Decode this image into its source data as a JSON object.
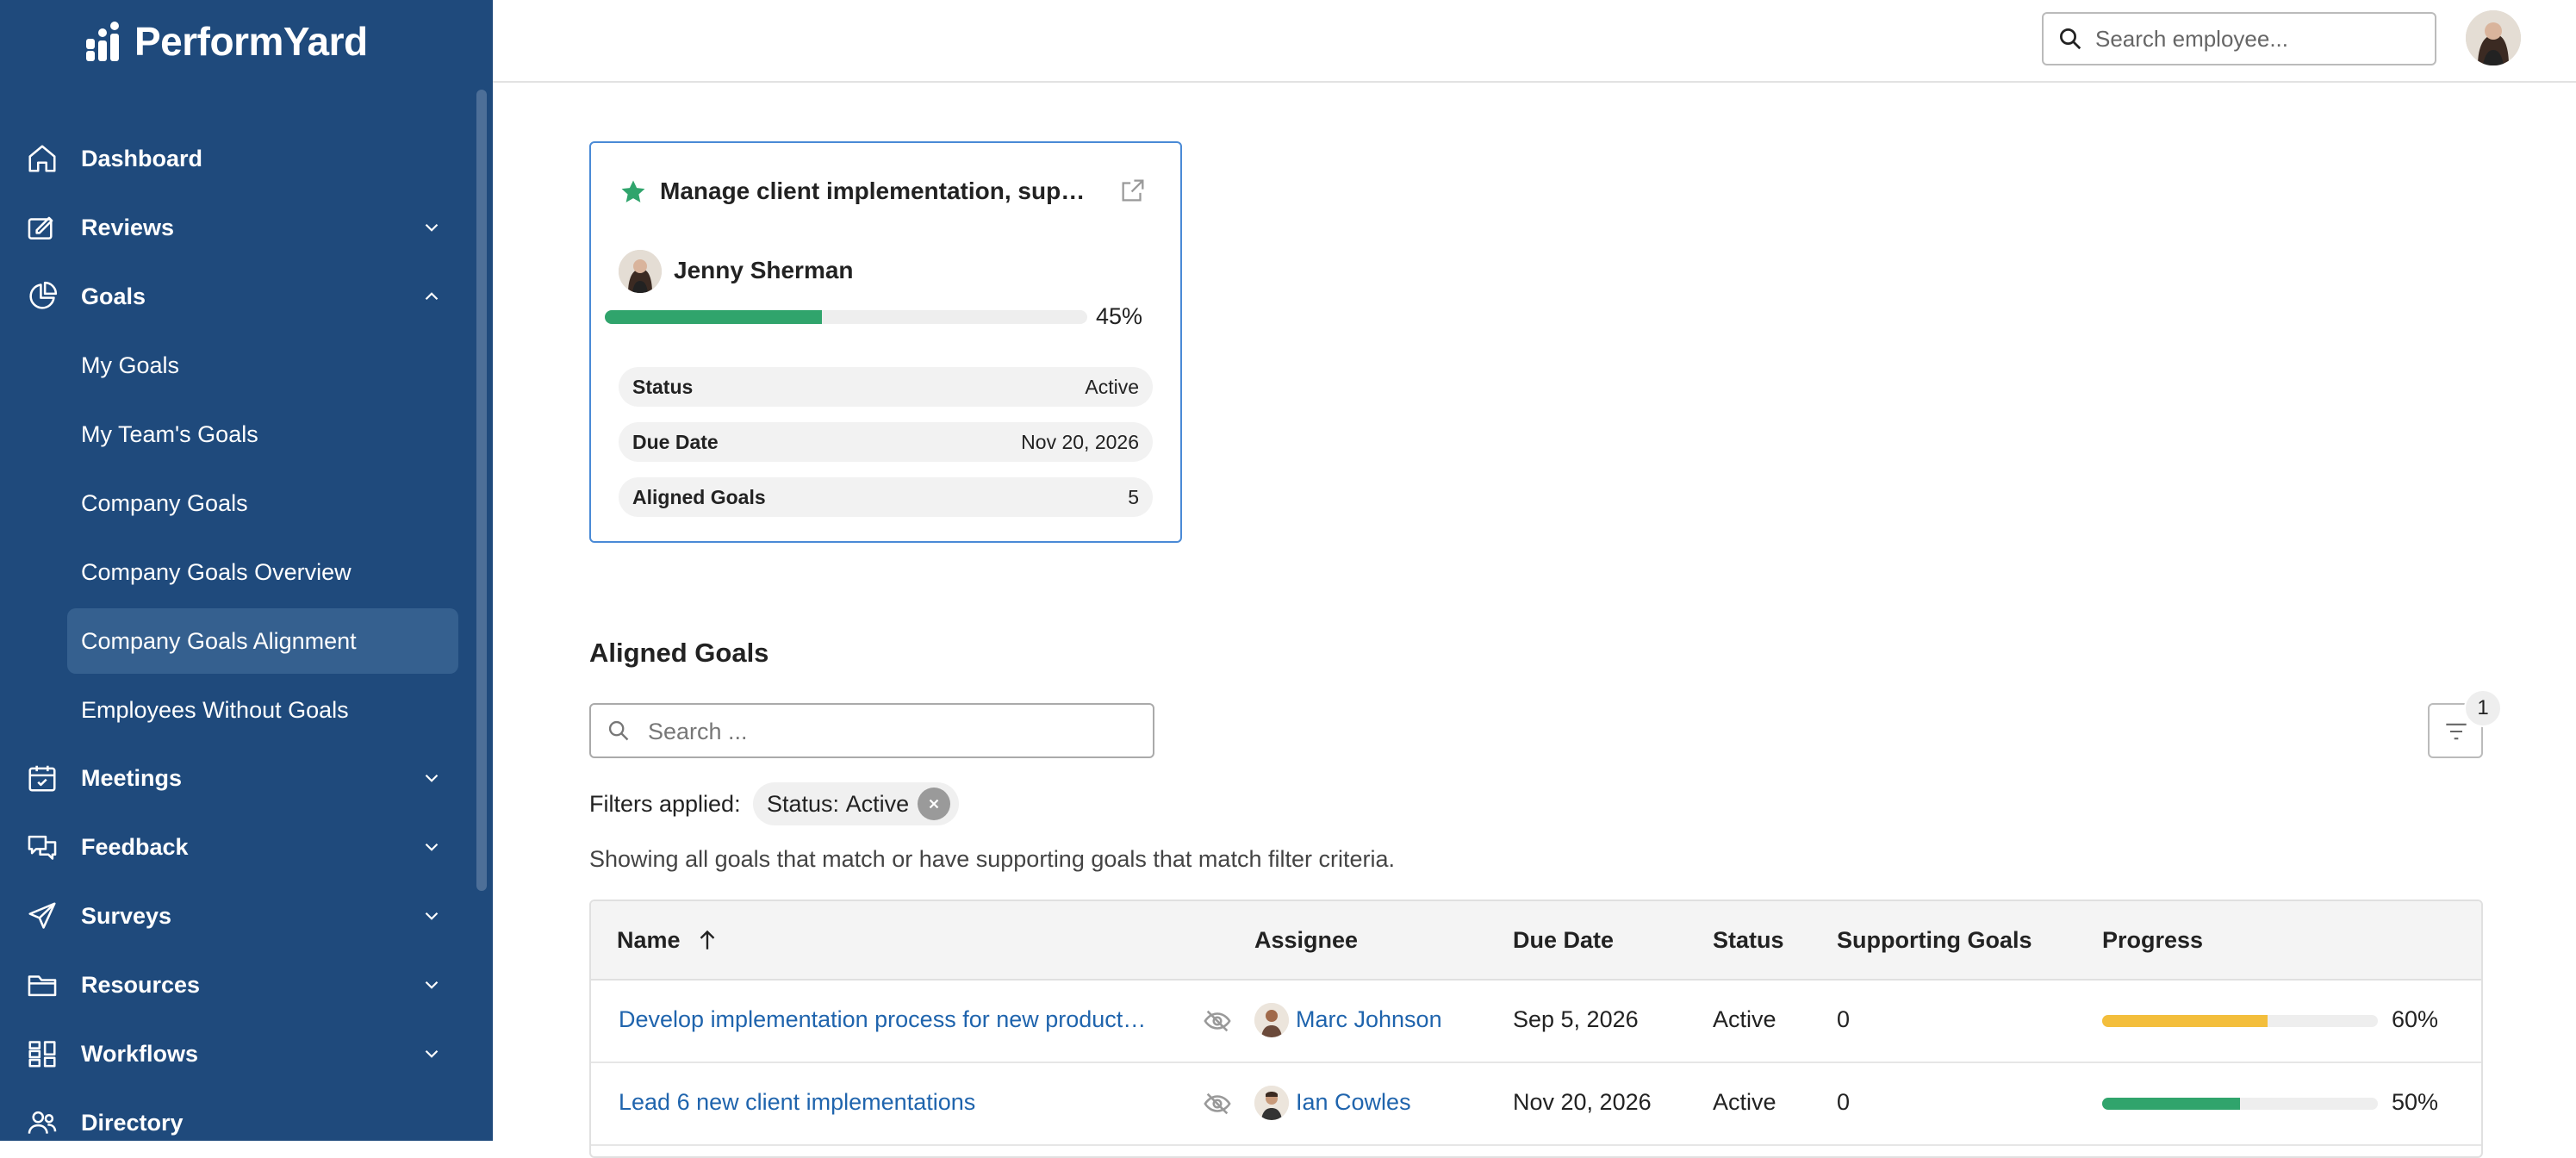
{
  "app": {
    "logo_text": "PerformYard"
  },
  "sidebar": {
    "items": [
      {
        "label": "Dashboard",
        "icon": "home-icon"
      },
      {
        "label": "Reviews",
        "icon": "review-icon"
      },
      {
        "label": "Goals",
        "icon": "goals-pie-icon"
      },
      {
        "label": "Meetings",
        "icon": "calendar-icon"
      },
      {
        "label": "Feedback",
        "icon": "feedback-icon"
      },
      {
        "label": "Surveys",
        "icon": "send-icon"
      },
      {
        "label": "Resources",
        "icon": "folder-icon"
      },
      {
        "label": "Workflows",
        "icon": "workflow-icon"
      },
      {
        "label": "Directory",
        "icon": "people-icon"
      }
    ],
    "goals_sub": [
      {
        "label": "My Goals"
      },
      {
        "label": "My Team's Goals"
      },
      {
        "label": "Company Goals"
      },
      {
        "label": "Company Goals Overview"
      },
      {
        "label": "Company Goals Alignment"
      },
      {
        "label": "Employees Without Goals"
      }
    ],
    "active_item": "Company Goals Alignment"
  },
  "topbar": {
    "search_placeholder": "Search employee..."
  },
  "goal_card": {
    "title": "Manage client implementation, support and retention",
    "owner": "Jenny Sherman",
    "progress_percent": 45,
    "progress_label": "45%",
    "progress_color": "#30a46c",
    "details": [
      {
        "label": "Status",
        "value": "Active"
      },
      {
        "label": "Due Date",
        "value": "Nov 20, 2026"
      },
      {
        "label": "Aligned Goals",
        "value": "5"
      }
    ]
  },
  "aligned": {
    "title": "Aligned Goals",
    "search_placeholder": "Search ...",
    "filter_count": "1",
    "filters_label": "Filters applied:",
    "chip_key": "Status:",
    "chip_value": "Active",
    "note": "Showing all goals that match or have supporting goals that match filter criteria."
  },
  "table": {
    "columns": [
      "Name",
      "Assignee",
      "Due Date",
      "Status",
      "Supporting Goals",
      "Progress"
    ],
    "rows": [
      {
        "name": "Develop implementation process for new product…",
        "assignee": "Marc Johnson",
        "due": "Sep 5, 2026",
        "status": "Active",
        "supporting": "0",
        "progress_percent": 60,
        "progress_label": "60%",
        "progress_color": "#f3be3c"
      },
      {
        "name": "Lead 6 new client implementations",
        "assignee": "Ian Cowles",
        "due": "Nov 20, 2026",
        "status": "Active",
        "supporting": "0",
        "progress_percent": 50,
        "progress_label": "50%",
        "progress_color": "#30a46c"
      }
    ]
  }
}
